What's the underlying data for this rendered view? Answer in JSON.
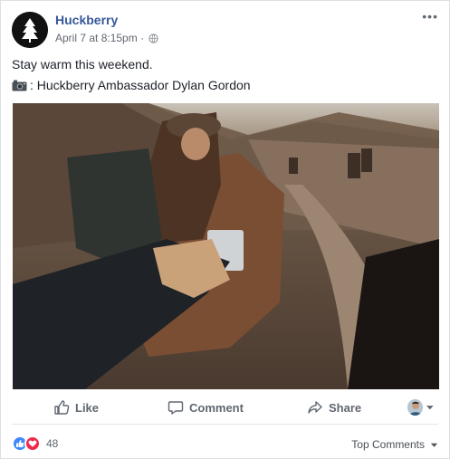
{
  "post": {
    "page_name": "Huckberry",
    "timestamp": "April 7 at 8:15pm",
    "separator": "·",
    "more_label": "•••",
    "text_line1": "Stay warm this weekend.",
    "text_line2": ": Huckberry Ambassador Dylan Gordon"
  },
  "actions": {
    "like_label": "Like",
    "comment_label": "Comment",
    "share_label": "Share"
  },
  "footer": {
    "reaction_count": "48",
    "sort_label": "Top Comments"
  },
  "colors": {
    "link_blue": "#365899",
    "meta_gray": "#616770",
    "action_gray": "#606770",
    "like_blue": "#3f87ff",
    "love_red": "#f0284a"
  },
  "icons": [
    "huckberry-logo-icon",
    "globe-icon",
    "camera-icon",
    "like-icon",
    "comment-icon",
    "share-icon",
    "chevron-down-icon",
    "like-reaction-icon",
    "love-reaction-icon"
  ]
}
